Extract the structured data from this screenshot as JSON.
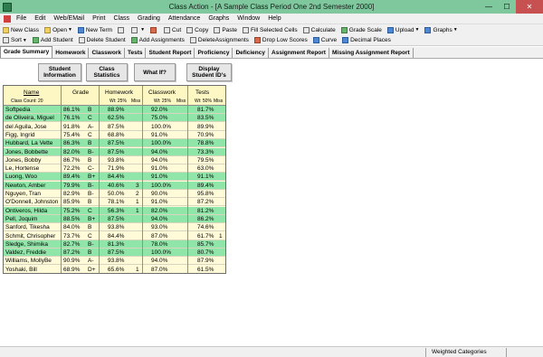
{
  "window": {
    "title": "Class Action - [A Sample Class Period One 2nd Semester 2000]",
    "minimize": "—",
    "maximize": "☐",
    "close": "✕"
  },
  "menu": [
    "File",
    "Edit",
    "Web/EMail",
    "Print",
    "Class",
    "Grading",
    "Attendance",
    "Graphs",
    "Window",
    "Help"
  ],
  "toolbar1": [
    {
      "label": "New Class",
      "icon": "new-class-icon",
      "color": "y"
    },
    {
      "label": "Open",
      "icon": "open-folder-icon",
      "color": "y",
      "dropdown": true
    },
    {
      "label": "New Term",
      "icon": "new-term-icon",
      "color": "b"
    },
    {
      "label": "",
      "icon": "print-icon",
      "color": "",
      "dropdown": false
    },
    {
      "label": "",
      "icon": "printer-setup-icon",
      "color": "",
      "dropdown": true
    },
    {
      "label": "",
      "icon": "table-icon",
      "color": "r"
    },
    {
      "label": "Cut",
      "icon": "cut-icon",
      "color": ""
    },
    {
      "label": "Copy",
      "icon": "copy-icon",
      "color": ""
    },
    {
      "label": "Paste",
      "icon": "paste-icon",
      "color": ""
    },
    {
      "label": "Fill Selected Cells",
      "icon": "fill-cells-icon",
      "color": ""
    },
    {
      "label": "Calculate",
      "icon": "calculate-icon",
      "color": ""
    },
    {
      "label": "Grade Scale",
      "icon": "grade-scale-icon",
      "color": "g"
    },
    {
      "label": "Upload",
      "icon": "upload-icon",
      "color": "b",
      "dropdown": true
    },
    {
      "label": "Graphs",
      "icon": "graphs-icon",
      "color": "b",
      "dropdown": true
    }
  ],
  "toolbar2": [
    {
      "label": "Sort",
      "icon": "sort-icon",
      "color": "",
      "dropdown": true
    },
    {
      "label": "Add Student",
      "icon": "add-student-icon",
      "color": "g"
    },
    {
      "label": "Delete Student",
      "icon": "delete-student-icon",
      "color": ""
    },
    {
      "label": "Add Assignments",
      "icon": "add-assignments-icon",
      "color": "g"
    },
    {
      "label": "DeleteAssignments",
      "icon": "delete-assignments-icon",
      "color": ""
    },
    {
      "label": "Drop Low Scores",
      "icon": "drop-low-scores-icon",
      "color": "r"
    },
    {
      "label": "Curve",
      "icon": "curve-icon",
      "color": "b"
    },
    {
      "label": "Decimal Places",
      "icon": "decimal-places-icon",
      "color": "b"
    }
  ],
  "tabs": [
    "Grade Summary",
    "Homework",
    "Classwork",
    "Tests",
    "Student Report",
    "Proficiency",
    "Deficiency",
    "Assignment Report",
    "Missing Assignment Report"
  ],
  "actions": {
    "student_info": [
      "Student",
      "Information"
    ],
    "class_stats": [
      "Class",
      "Statistics"
    ],
    "what_if": "What If?",
    "display_ids": [
      "Display",
      "Student ID's"
    ]
  },
  "grid": {
    "name_header": "Name",
    "class_count": "Class Count: 20",
    "grade_header": "Grade",
    "homework_header": "Homework",
    "homework_wt": "Wt: 25%",
    "homework_miss": "Miss",
    "classwork_header": "Classwork",
    "classwork_wt": "Wt: 25%",
    "classwork_miss": "Miss",
    "tests_header": "Tests",
    "tests_wt": "Wt: 50%",
    "tests_miss": "Miss",
    "rows": [
      {
        "name": "Softpedia",
        "pct": "86.1%",
        "letter": "B",
        "hw": "88.9%",
        "hwm": "",
        "cw": "92.0%",
        "cwm": "",
        "t": "81.7%",
        "tm": "",
        "hl": true
      },
      {
        "name": "de Oliveira, Miguel",
        "pct": "76.1%",
        "letter": "C",
        "hw": "62.5%",
        "hwm": "",
        "cw": "75.0%",
        "cwm": "",
        "t": "83.5%",
        "tm": "",
        "hl": true
      },
      {
        "name": "del Aguila, Jose",
        "pct": "91.8%",
        "letter": "A-",
        "hw": "87.5%",
        "hwm": "",
        "cw": "100.0%",
        "cwm": "",
        "t": "89.9%",
        "tm": "",
        "hl": false
      },
      {
        "name": "Figg, Ingrid",
        "pct": "75.4%",
        "letter": "C",
        "hw": "68.8%",
        "hwm": "",
        "cw": "91.0%",
        "cwm": "",
        "t": "70.9%",
        "tm": "",
        "hl": false
      },
      {
        "name": "Hubbard, La Vette",
        "pct": "86.3%",
        "letter": "B",
        "hw": "87.5%",
        "hwm": "",
        "cw": "100.0%",
        "cwm": "",
        "t": "78.8%",
        "tm": "",
        "hl": true
      },
      {
        "name": "Jones, Bobbette",
        "pct": "82.0%",
        "letter": "B-",
        "hw": "87.5%",
        "hwm": "",
        "cw": "94.0%",
        "cwm": "",
        "t": "73.3%",
        "tm": "",
        "hl": true
      },
      {
        "name": "Jones, Bobby",
        "pct": "86.7%",
        "letter": "B",
        "hw": "93.8%",
        "hwm": "",
        "cw": "94.0%",
        "cwm": "",
        "t": "79.5%",
        "tm": "",
        "hl": false
      },
      {
        "name": "Le, Hortense",
        "pct": "72.2%",
        "letter": "C-",
        "hw": "71.9%",
        "hwm": "",
        "cw": "91.0%",
        "cwm": "",
        "t": "63.0%",
        "tm": "",
        "hl": false
      },
      {
        "name": "Luong, Woo",
        "pct": "89.4%",
        "letter": "B+",
        "hw": "84.4%",
        "hwm": "",
        "cw": "91.0%",
        "cwm": "",
        "t": "91.1%",
        "tm": "",
        "hl": true
      },
      {
        "name": "Newton, Amber",
        "pct": "79.9%",
        "letter": "B-",
        "hw": "40.6%",
        "hwm": "3",
        "cw": "100.0%",
        "cwm": "",
        "t": "89.4%",
        "tm": "",
        "hl": true
      },
      {
        "name": "Nguyen, Tran",
        "pct": "82.9%",
        "letter": "B-",
        "hw": "50.0%",
        "hwm": "2",
        "cw": "90.0%",
        "cwm": "",
        "t": "95.8%",
        "tm": "",
        "hl": false
      },
      {
        "name": "O'Donnell, Johnston",
        "pct": "85.9%",
        "letter": "B",
        "hw": "78.1%",
        "hwm": "1",
        "cw": "91.0%",
        "cwm": "",
        "t": "87.2%",
        "tm": "",
        "hl": false
      },
      {
        "name": "Ontiveros, Hilda",
        "pct": "75.2%",
        "letter": "C",
        "hw": "56.3%",
        "hwm": "1",
        "cw": "82.0%",
        "cwm": "",
        "t": "81.2%",
        "tm": "",
        "hl": true
      },
      {
        "name": "Pell, Joquim",
        "pct": "88.5%",
        "letter": "B+",
        "hw": "87.5%",
        "hwm": "",
        "cw": "94.0%",
        "cwm": "",
        "t": "86.2%",
        "tm": "",
        "hl": true
      },
      {
        "name": "Sanford, Tikesha",
        "pct": "84.0%",
        "letter": "B",
        "hw": "93.8%",
        "hwm": "",
        "cw": "93.0%",
        "cwm": "",
        "t": "74.6%",
        "tm": "",
        "hl": false
      },
      {
        "name": "Schmit, Chrisopher",
        "pct": "73.7%",
        "letter": "C",
        "hw": "84.4%",
        "hwm": "",
        "cw": "87.0%",
        "cwm": "",
        "t": "61.7%",
        "tm": "1",
        "hl": false
      },
      {
        "name": "Sledge, Shimika",
        "pct": "82.7%",
        "letter": "B-",
        "hw": "81.3%",
        "hwm": "",
        "cw": "78.0%",
        "cwm": "",
        "t": "85.7%",
        "tm": "",
        "hl": true
      },
      {
        "name": "Valdez, Freddie",
        "pct": "87.2%",
        "letter": "B",
        "hw": "87.5%",
        "hwm": "",
        "cw": "100.0%",
        "cwm": "",
        "t": "80.7%",
        "tm": "",
        "hl": true
      },
      {
        "name": "Williams, MollyBe",
        "pct": "90.9%",
        "letter": "A-",
        "hw": "93.8%",
        "hwm": "",
        "cw": "94.0%",
        "cwm": "",
        "t": "87.9%",
        "tm": "",
        "hl": false
      },
      {
        "name": "Yoshaki, Bill",
        "pct": "68.9%",
        "letter": "D+",
        "hw": "65.6%",
        "hwm": "1",
        "cw": "87.0%",
        "cwm": "",
        "t": "61.5%",
        "tm": "",
        "hl": false
      }
    ]
  },
  "status": {
    "weighting": "Weighted Categories"
  },
  "colors": {
    "titlebar": "#7fc89d",
    "highlight_row": "#8fe6a8",
    "grid_bg": "#fffbd8",
    "close_button": "#c75050"
  }
}
